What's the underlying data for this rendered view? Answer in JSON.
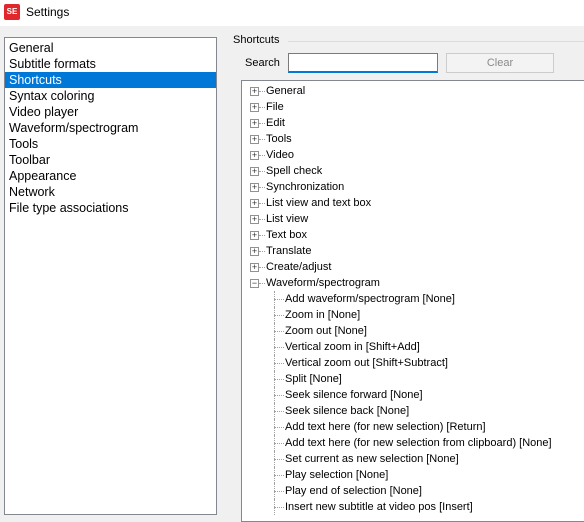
{
  "window": {
    "title": "Settings",
    "icon": "subtitle-edit-icon"
  },
  "sections": [
    {
      "label": "General",
      "selected": false
    },
    {
      "label": "Subtitle formats",
      "selected": false
    },
    {
      "label": "Shortcuts",
      "selected": true
    },
    {
      "label": "Syntax coloring",
      "selected": false
    },
    {
      "label": "Video player",
      "selected": false
    },
    {
      "label": "Waveform/spectrogram",
      "selected": false
    },
    {
      "label": "Tools",
      "selected": false
    },
    {
      "label": "Toolbar",
      "selected": false
    },
    {
      "label": "Appearance",
      "selected": false
    },
    {
      "label": "Network",
      "selected": false
    },
    {
      "label": "File type associations",
      "selected": false
    }
  ],
  "shortcuts": {
    "group_label": "Shortcuts",
    "search_label": "Search",
    "search_value": "",
    "clear_label": "Clear",
    "tree": [
      {
        "label": "General",
        "expanded": false,
        "children": []
      },
      {
        "label": "File",
        "expanded": false,
        "children": []
      },
      {
        "label": "Edit",
        "expanded": false,
        "children": []
      },
      {
        "label": "Tools",
        "expanded": false,
        "children": []
      },
      {
        "label": "Video",
        "expanded": false,
        "children": []
      },
      {
        "label": "Spell check",
        "expanded": false,
        "children": []
      },
      {
        "label": "Synchronization",
        "expanded": false,
        "children": []
      },
      {
        "label": "List view and text box",
        "expanded": false,
        "children": []
      },
      {
        "label": "List view",
        "expanded": false,
        "children": []
      },
      {
        "label": "Text box",
        "expanded": false,
        "children": []
      },
      {
        "label": "Translate",
        "expanded": false,
        "children": []
      },
      {
        "label": "Create/adjust",
        "expanded": false,
        "children": []
      },
      {
        "label": "Waveform/spectrogram",
        "expanded": true,
        "children": [
          "Add waveform/spectrogram [None]",
          "Zoom in [None]",
          "Zoom out [None]",
          "Vertical zoom in [Shift+Add]",
          "Vertical zoom out [Shift+Subtract]",
          "Split [None]",
          "Seek silence forward [None]",
          "Seek silence back [None]",
          "Add text here (for new selection) [Return]",
          "Add text here (for new selection from clipboard) [None]",
          "Set current as new selection [None]",
          "Play selection [None]",
          "Play end of selection [None]",
          "Insert new subtitle at video pos [Insert]"
        ]
      }
    ]
  }
}
